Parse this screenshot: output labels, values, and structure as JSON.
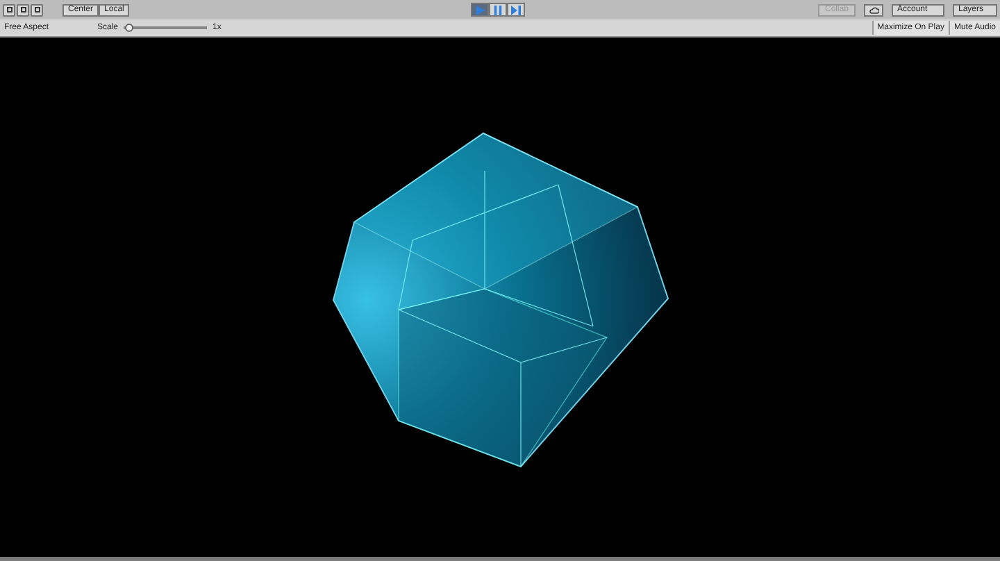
{
  "toolbar": {
    "pivot_buttons": [
      {
        "label": "Center"
      },
      {
        "label": "Local"
      }
    ],
    "play_controls": [
      {
        "kind": "play",
        "selected": true
      },
      {
        "kind": "pause",
        "selected": false
      },
      {
        "kind": "step",
        "selected": false
      }
    ],
    "collab": {
      "label": "Collab",
      "disabled": true
    },
    "account": {
      "label": "Account"
    },
    "layers": {
      "label": "Layers"
    }
  },
  "game_bar": {
    "aspect": "Free Aspect",
    "scale_label": "Scale",
    "scale": {
      "level": 0.02
    },
    "scale_reading": "1x",
    "toggles": [
      {
        "label": "Maximize On Play",
        "selected": false
      },
      {
        "label": "Mute Audio",
        "selected": false
      }
    ]
  }
}
